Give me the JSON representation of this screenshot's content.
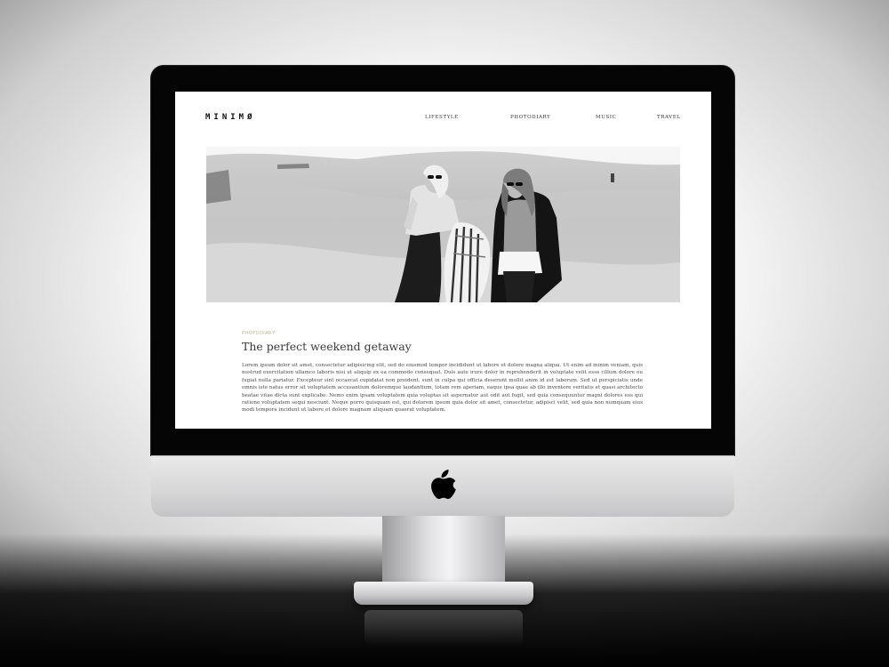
{
  "site": {
    "logo": "MINIMØ",
    "nav": [
      {
        "label": "LIFESTYLE"
      },
      {
        "label": "PHOTODIARY"
      },
      {
        "label": "MUSIC"
      },
      {
        "label": "TRAVEL"
      }
    ]
  },
  "post": {
    "category": "PHOTODIARY",
    "title": "The perfect weekend getaway",
    "body": "Lorem ipsum dolor sit amet, consectetur adipisicing elit, sed do eiusmod tempor incididunt ut labore et dolore magna aliqua. Ut enim ad minim veniam, quis nostrud exercitation ullamco laboris nisi ut aliquip ex ea commodo consequat. Duis aute irure dolor in reprehenderit in voluptate velit esse cillum dolore eu fugiat nulla pariatur. Excepteur sint occaecat cupidatat non proident, sunt in culpa qui officia deserunt mollit anim id est laborum. Sed ut perspiciatis unde omnis iste natus error sit voluptatem accusantium doloremque laudantium, totam rem aperiam, eaque ipsa quae ab illo inventore veritatis et quasi architecto beatae vitae dicta sunt explicabo. Nemo enim ipsam voluptatem quia voluptas sit aspernatur aut odit aut fugit, sed quia consequuntur magni dolores eos qui ratione voluptatem sequi nesciunt. Neque porro quisquam est, qui dolorem ipsum quia dolor sit amet, consectetur, adipisci velit, sed quia non numquam eius modi tempora incidunt ut labore et dolore magnam aliquam quaerat voluptatem."
  },
  "colors": {
    "screen_background": "#ffffff",
    "category_accent": "#b7b29a",
    "bezel": "#050505",
    "aluminium": "#d8d8d9"
  },
  "icons": {
    "chin_logo": "apple-logo-icon"
  }
}
